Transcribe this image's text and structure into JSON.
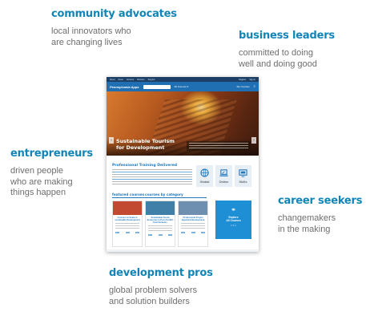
{
  "personas": [
    {
      "title": "community advocates",
      "description_lines": [
        "local innovators who",
        "are changing lives"
      ]
    },
    {
      "title": "business leaders",
      "description_lines": [
        "committed to doing",
        "well and doing good"
      ]
    },
    {
      "title": "entrepreneurs",
      "description_lines": [
        "driven people",
        "who are making",
        "things happen"
      ]
    },
    {
      "title": "career seekers",
      "description_lines": [
        "changemakers",
        "in the making"
      ]
    },
    {
      "title": "development pros",
      "description_lines": [
        "global problem solvers",
        "and solution builders"
      ]
    }
  ],
  "site": {
    "top_links": [
      "About",
      "News",
      "Courses",
      "Partners",
      "Support"
    ],
    "top_right_links": [
      "Register",
      "Sign in"
    ],
    "logo": "Pennsylvania Apps",
    "nav_all_courses": "All Courses ▾",
    "nav_my_courses": "My Courses",
    "hero": {
      "title_lines": [
        "Sustainable Tourism",
        "for Development"
      ],
      "prev_arrow": "‹",
      "next_arrow": "›"
    },
    "training_heading": "Professional Training Delivered",
    "tiles": [
      {
        "label": "Global",
        "icon": "globe-icon",
        "color": "#1f78c0"
      },
      {
        "label": "Online",
        "icon": "laptop-icon",
        "color": "#1f78c0"
      },
      {
        "label": "Skills",
        "icon": "skills-icon",
        "color": "#1f78c0"
      }
    ],
    "section_tabs": [
      "featured courses",
      "courses by category"
    ],
    "cards": [
      {
        "title": "Courses on Scale to sustainable Development",
        "image_color": "#c24a32"
      },
      {
        "title": "Sustainable Social Enterprise in Post-Conflict Environments",
        "image_color": "#3f7fa8"
      },
      {
        "title": "Professional Project Appraisal Development",
        "image_color": "#6e8fb0"
      }
    ],
    "explore": {
      "icon": "lightbulb-icon",
      "label_lines": [
        "Explore",
        "All Courses"
      ],
      "more": "• • •"
    }
  }
}
